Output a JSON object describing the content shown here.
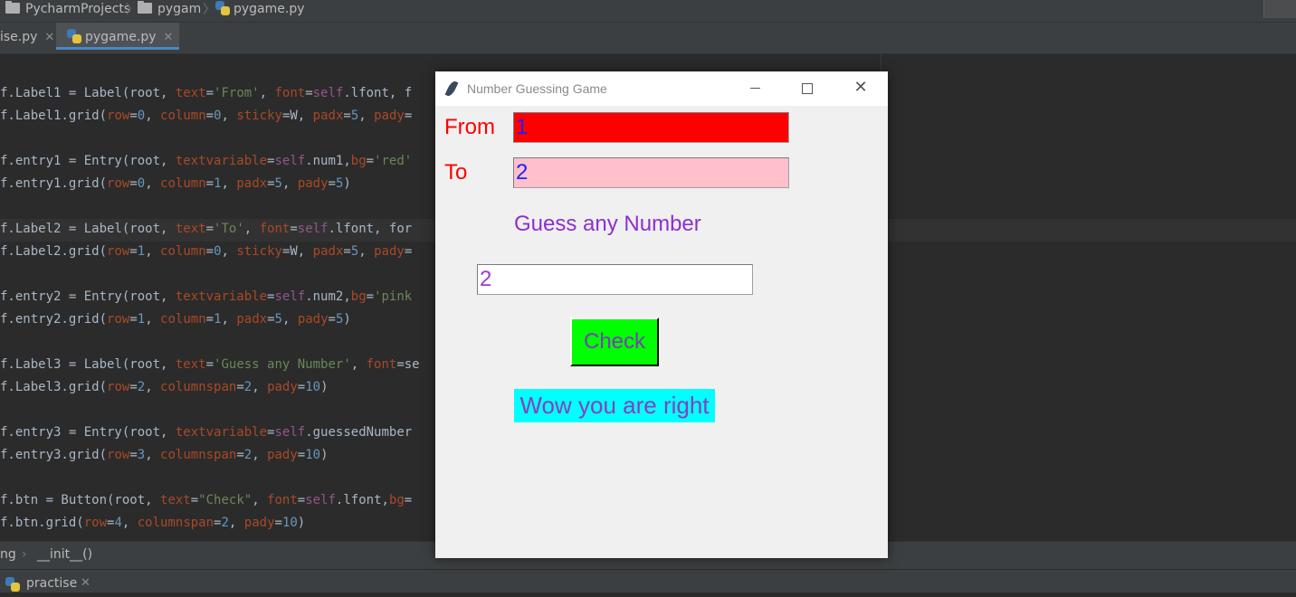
{
  "ide": {
    "breadcrumbs": [
      "PycharmProjects",
      "pygam",
      "pygame.py"
    ],
    "tabs": [
      {
        "label": "ise.py"
      },
      {
        "label": "pygame.py",
        "active": true
      }
    ],
    "code_lines": [
      "f.Label1 = Label(root, text='From', font=self.lfont, f",
      "f.Label1.grid(row=0, column=0, sticky=W, padx=5, pady=",
      "",
      "f.entry1 = Entry(root, textvariable=self.num1,bg='red'",
      "f.entry1.grid(row=0, column=1, padx=5, pady=5)",
      "",
      "f.Label2 = Label(root, text='To', font=self.lfont, for",
      "f.Label2.grid(row=1, column=0, sticky=W, padx=5, pady=",
      "",
      "f.entry2 = Entry(root, textvariable=self.num2,bg='pink",
      "f.entry2.grid(row=1, column=1, padx=5, pady=5)",
      "",
      "f.Label3 = Label(root, text='Guess any Number', font=se",
      "f.Label3.grid(row=2, columnspan=2, pady=10)",
      "",
      "f.entry3 = Entry(root, textvariable=self.guessedNumber",
      "f.entry3.grid(row=3, columnspan=2, pady=10)",
      "",
      "f.btn = Button(root, text=\"Check\", font=self.lfont,bg=",
      "f.btn.grid(row=4, columnspan=2, pady=10)"
    ],
    "status_breadcrumb": [
      "ng",
      "__init__()"
    ],
    "run_tab": "practise"
  },
  "tk": {
    "title": "Number Guessing Game",
    "from_label": "From",
    "to_label": "To",
    "from_value": "1",
    "to_value": "2",
    "prompt": "Guess any Number",
    "guess_value": "2",
    "check_label": "Check",
    "result": "Wow you are right"
  },
  "colors": {
    "from_entry_bg": "#ff0000",
    "to_entry_bg": "#ffc0cb",
    "check_button_bg": "#00ff00",
    "result_bg": "#00ffff",
    "label_red": "#ff0000",
    "text_purple": "#8a2be2"
  },
  "icons": [
    "folder-icon",
    "python-file-icon",
    "close-icon",
    "feather-icon",
    "minimize-icon",
    "maximize-icon"
  ]
}
